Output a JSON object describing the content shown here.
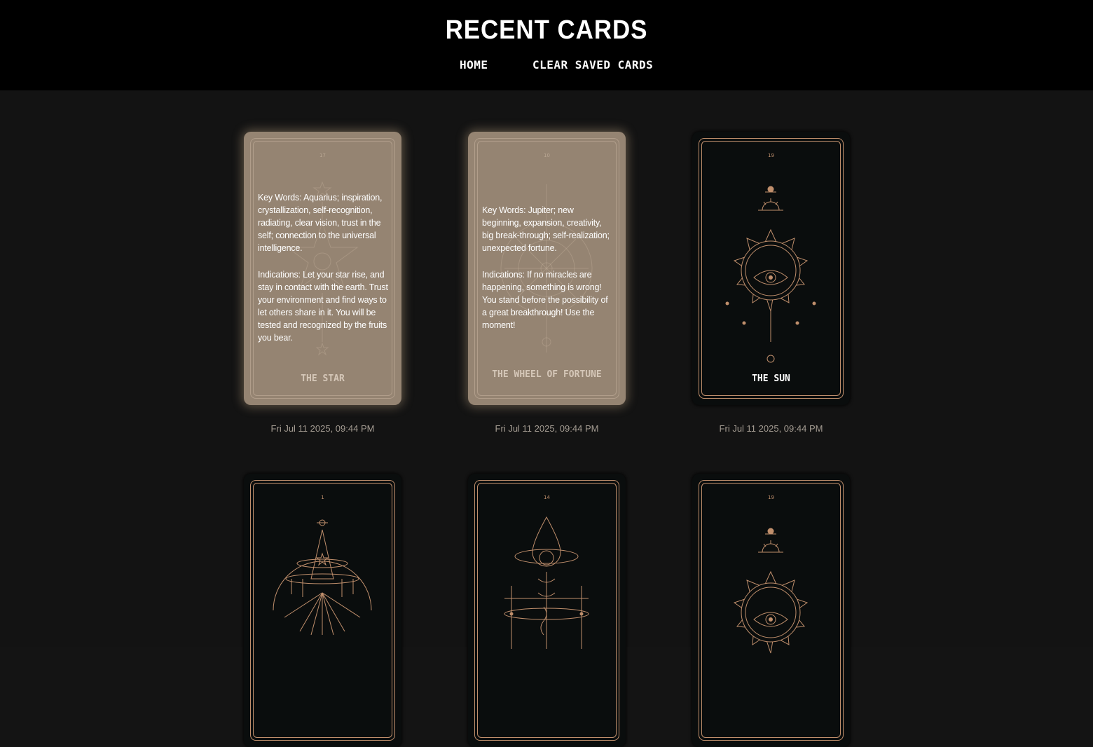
{
  "header": {
    "title": "RECENT CARDS",
    "nav": [
      {
        "label": "HOME"
      },
      {
        "label": "CLEAR SAVED CARDS"
      }
    ]
  },
  "cards": [
    {
      "name": "THE STAR",
      "number": "17",
      "state": "flipped",
      "keywords": "Key Words: Aquarius; inspiration, crystallization, self-recognition, radiating, clear vision, trust in the self; connection to the universal intelligence.",
      "indications": "Indications: Let your star rise, and stay in contact with the earth. Trust your environment and find ways to let others share in it. You will be tested and recognized by the fruits you bear.",
      "date": "Fri Jul 11 2025, 09:44 PM"
    },
    {
      "name": "THE WHEEL OF FORTUNE",
      "number": "10",
      "state": "flipped",
      "keywords": "Key Words: Jupiter; new beginning, expansion, creativity, big break-through; self-realization; unexpected fortune.",
      "indications": "Indications: If no miracles are happening, something is wrong! You stand before the possibility of a great breakthrough! Use the moment!",
      "date": "Fri Jul 11 2025, 09:44 PM"
    },
    {
      "name": "THE SUN",
      "number": "19",
      "state": "front",
      "date": "Fri Jul 11 2025, 09:44 PM"
    },
    {
      "number": "1",
      "state": "front"
    },
    {
      "number": "14",
      "state": "front"
    },
    {
      "number": "19",
      "state": "front"
    }
  ],
  "colors": {
    "background": "#131313",
    "header": "#000000",
    "card_front": "#0a0d0d",
    "card_flipped": "#958472",
    "gold_line": "#c08f6c",
    "date_text": "#a49c92"
  }
}
